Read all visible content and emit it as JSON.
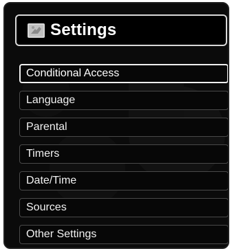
{
  "window": {
    "title": "Settings",
    "title_icon": "settings-icon"
  },
  "menu": {
    "selected_index": 0,
    "items": [
      {
        "label": "Conditional Access"
      },
      {
        "label": "Language"
      },
      {
        "label": "Parental"
      },
      {
        "label": "Timers"
      },
      {
        "label": "Date/Time"
      },
      {
        "label": "Sources"
      },
      {
        "label": "Other Settings"
      }
    ]
  },
  "colors": {
    "panel_background": "#0b0b0b",
    "selected_border": "#f0f0f0",
    "item_border": "#4a4a4a",
    "text": "#ffffff"
  }
}
